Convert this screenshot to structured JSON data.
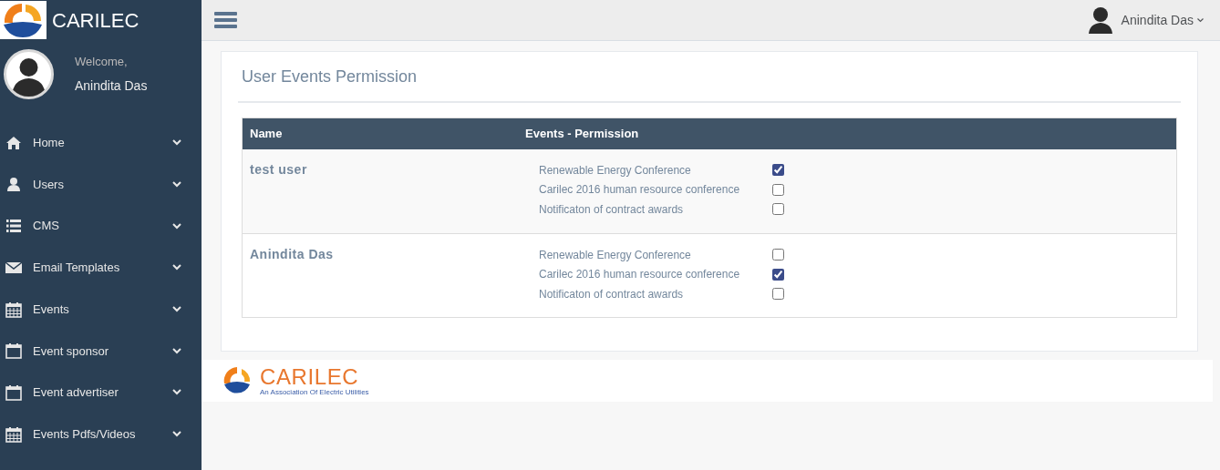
{
  "brand": {
    "name": "CARILEC"
  },
  "profile": {
    "greeting": "Welcome,",
    "name": "Anindita Das"
  },
  "sidebar": {
    "items": [
      {
        "label": "Home",
        "kind": "home"
      },
      {
        "label": "Users",
        "kind": "user"
      },
      {
        "label": "CMS",
        "kind": "list"
      },
      {
        "label": "Email Templates",
        "kind": "envelope"
      },
      {
        "label": "Events",
        "kind": "calendar"
      },
      {
        "label": "Event sponsor",
        "kind": "calendar-outline"
      },
      {
        "label": "Event advertiser",
        "kind": "calendar-outline"
      },
      {
        "label": "Events Pdfs/Videos",
        "kind": "calendar"
      }
    ]
  },
  "topbar": {
    "user": "Anindita Das"
  },
  "panel": {
    "title": "User Events Permission",
    "table": {
      "columns": [
        "Name",
        "Events - Permission"
      ],
      "rows": [
        {
          "name": "test user",
          "events": [
            {
              "label": "Renewable Energy Conference",
              "checked": true
            },
            {
              "label": "Carilec 2016 human resource conference",
              "checked": false
            },
            {
              "label": "Notificaton of contract awards",
              "checked": false
            }
          ]
        },
        {
          "name": "Anindita Das",
          "events": [
            {
              "label": "Renewable Energy Conference",
              "checked": false
            },
            {
              "label": "Carilec 2016 human resource conference",
              "checked": true
            },
            {
              "label": "Notificaton of contract awards",
              "checked": false
            }
          ]
        }
      ]
    }
  },
  "footer": {
    "logo_text": "CARILEC",
    "tagline": "An Association Of Electric Utilities"
  }
}
